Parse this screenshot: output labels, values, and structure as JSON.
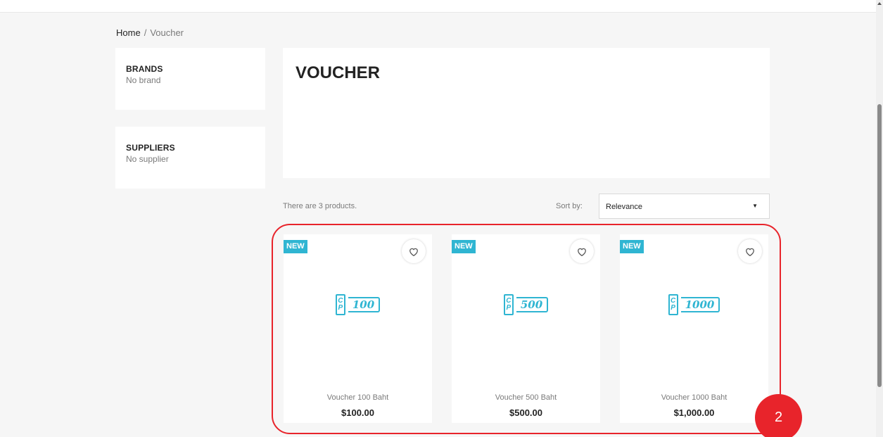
{
  "breadcrumb": {
    "home": "Home",
    "separator": "/",
    "current": "Voucher"
  },
  "sidebar": {
    "brands": {
      "title": "BRANDS",
      "value": "No brand"
    },
    "suppliers": {
      "title": "SUPPLIERS",
      "value": "No supplier"
    }
  },
  "category": {
    "title": "VOUCHER"
  },
  "listing": {
    "count_text": "There are 3 products.",
    "sort_label": "Sort by:",
    "sort_value": "Relevance",
    "sort_caret": "▼"
  },
  "products": [
    {
      "badge": "NEW",
      "logo_letters": "C P",
      "logo_amount": "100",
      "name": "Voucher 100 Baht",
      "price": "$100.00"
    },
    {
      "badge": "NEW",
      "logo_letters": "C P",
      "logo_amount": "500",
      "name": "Voucher 500 Baht",
      "price": "$500.00"
    },
    {
      "badge": "NEW",
      "logo_letters": "C P",
      "logo_amount": "1000",
      "name": "Voucher 1000 Baht",
      "price": "$1,000.00"
    }
  ],
  "annotation": {
    "step_number": "2"
  },
  "colors": {
    "accent": "#2fb5d2",
    "highlight": "#e8242b"
  },
  "icons": {
    "wishlist": "heart-outline-icon",
    "sort": "caret-down-icon"
  }
}
